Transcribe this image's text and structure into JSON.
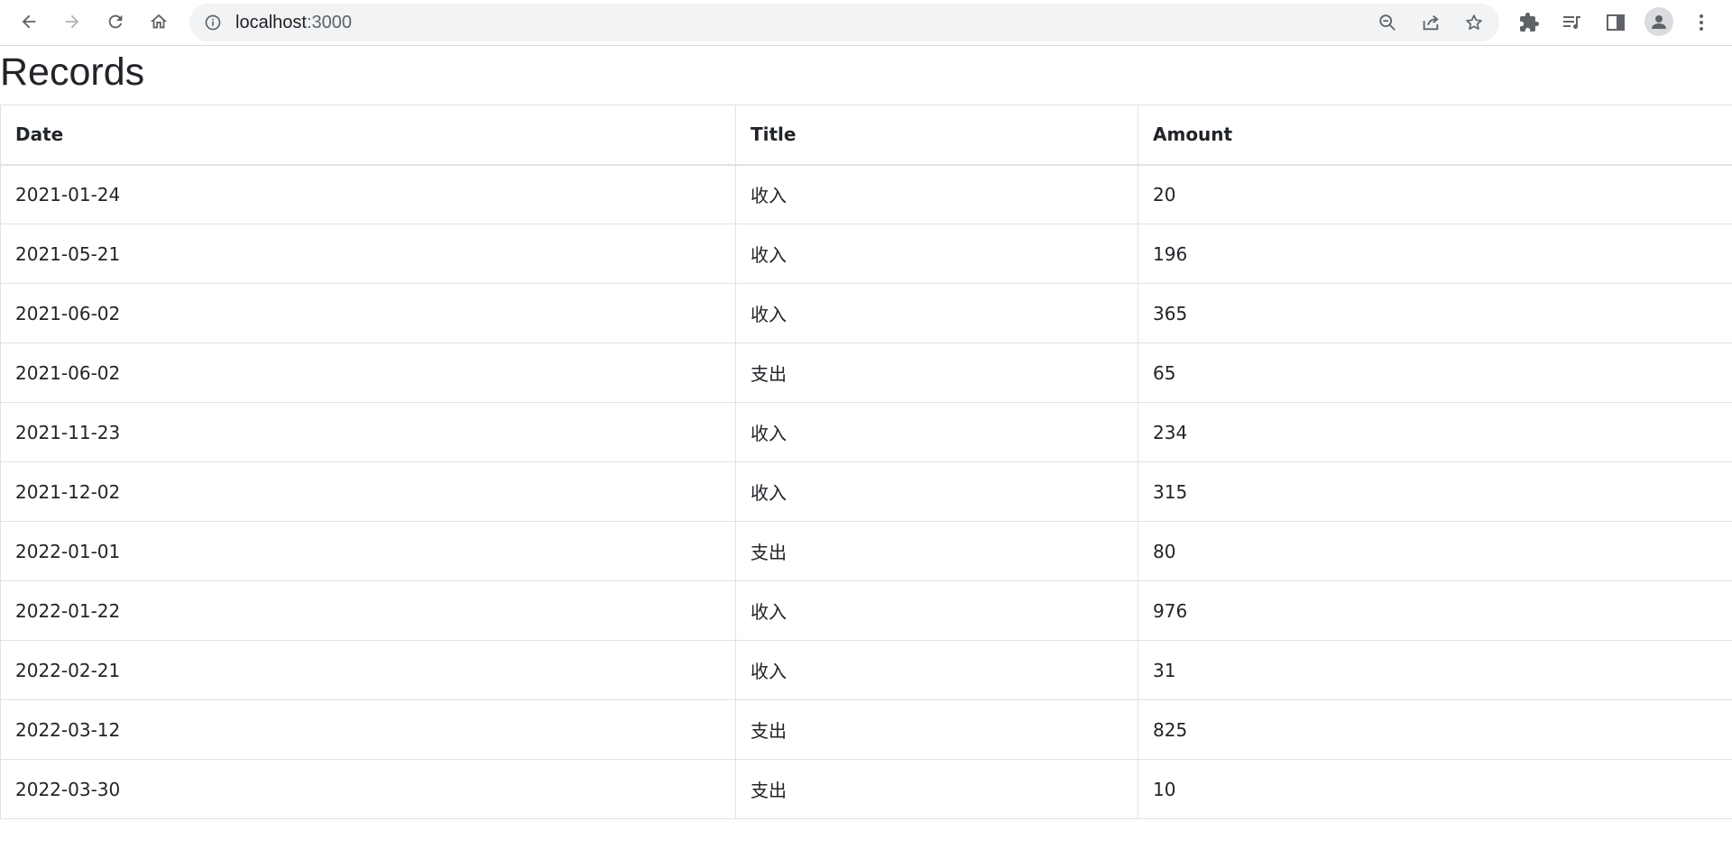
{
  "browser": {
    "url_host": "localhost",
    "url_port": ":3000"
  },
  "page": {
    "title": "Records"
  },
  "table": {
    "headers": [
      "Date",
      "Title",
      "Amount"
    ],
    "rows": [
      [
        "2021-01-24",
        "收入",
        "20"
      ],
      [
        "2021-05-21",
        "收入",
        "196"
      ],
      [
        "2021-06-02",
        "收入",
        "365"
      ],
      [
        "2021-06-02",
        "支出",
        "65"
      ],
      [
        "2021-11-23",
        "收入",
        "234"
      ],
      [
        "2021-12-02",
        "收入",
        "315"
      ],
      [
        "2022-01-01",
        "支出",
        "80"
      ],
      [
        "2022-01-22",
        "收入",
        "976"
      ],
      [
        "2022-02-21",
        "收入",
        "31"
      ],
      [
        "2022-03-12",
        "支出",
        "825"
      ],
      [
        "2022-03-30",
        "支出",
        "10"
      ]
    ]
  },
  "colors": {
    "toolbar_bg": "#ffffff",
    "omnibox_bg": "#f1f3f4",
    "icon": "#5f6368",
    "border": "#dee2e6",
    "text": "#212529"
  }
}
